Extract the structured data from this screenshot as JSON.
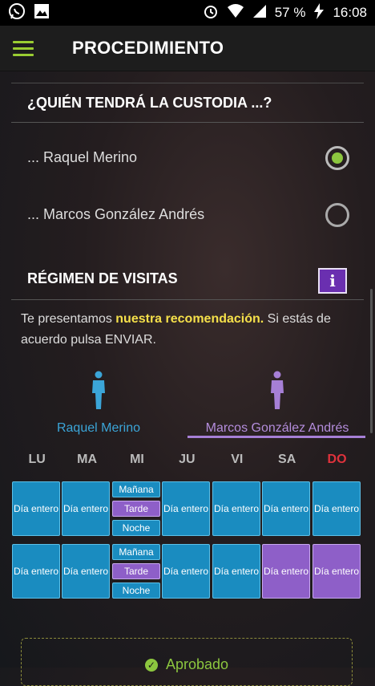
{
  "statusbar": {
    "battery": "57 %",
    "time": "16:08"
  },
  "appbar": {
    "title": "PROCEDIMIENTO"
  },
  "custody": {
    "heading": "¿QUIÉN TENDRÁ LA CUSTODIA ...?",
    "options": [
      {
        "label": "... Raquel Merino",
        "selected": true
      },
      {
        "label": "... Marcos González Andrés",
        "selected": false
      }
    ]
  },
  "visits": {
    "heading": "RÉGIMEN DE VISITAS",
    "info_label": "i",
    "reco_prefix": "Te presentamos ",
    "reco_highlight": "nuestra recomendación.",
    "reco_suffix": " Si estás de acuerdo pulsa ENVIAR.",
    "persons": [
      "Raquel Merino",
      "Marcos González Andrés"
    ],
    "days": [
      "LU",
      "MA",
      "MI",
      "JU",
      "VI",
      "SA",
      "DO"
    ],
    "cell_full": "Día entero",
    "split_labels": [
      "Mañana",
      "Tarde",
      "Noche"
    ]
  },
  "colors": {
    "blue": "#1a8cc0",
    "purple": "#8e5fc8",
    "green": "#8cc63f",
    "yellow": "#f5e04a",
    "red": "#e0323c"
  },
  "status": {
    "approved": "Aprobado"
  }
}
